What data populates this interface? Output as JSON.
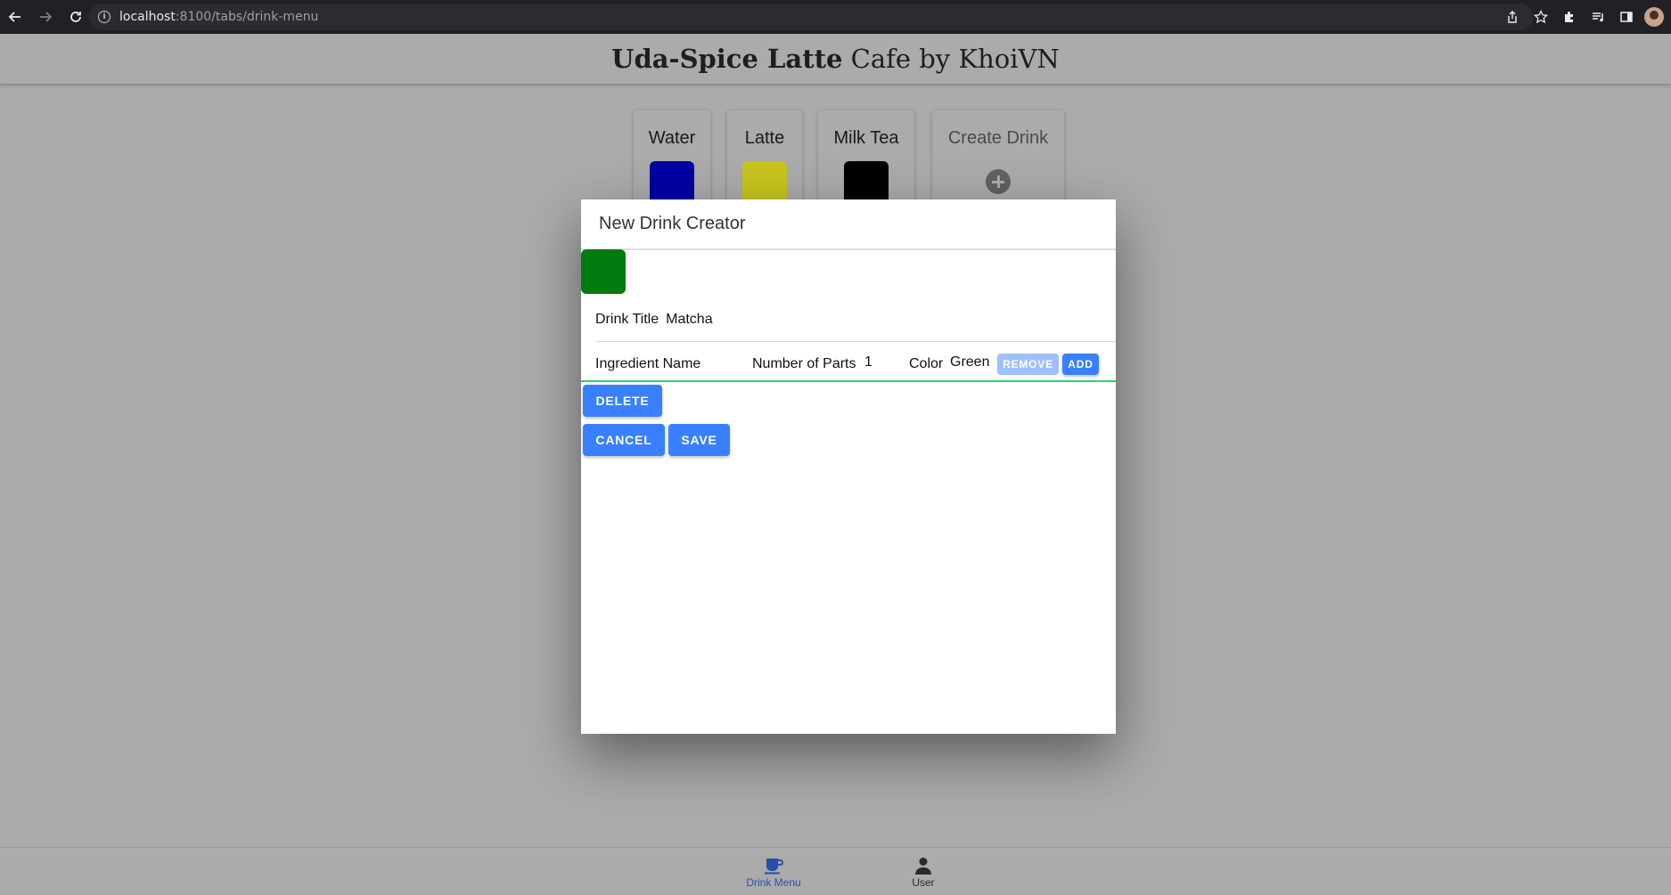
{
  "browser": {
    "url_host": "localhost",
    "url_path": ":8100/tabs/drink-menu"
  },
  "header": {
    "title_bold": "Uda-Spice Latte",
    "title_rest": " Cafe by KhoiVN"
  },
  "drinks": [
    {
      "title": "Water",
      "color": "#0000a3"
    },
    {
      "title": "Latte",
      "color": "#c8c51e"
    },
    {
      "title": "Milk Tea",
      "color": "#000000"
    }
  ],
  "create_card": {
    "title": "Create Drink",
    "icon": "plus-circle-icon"
  },
  "modal": {
    "title": "New Drink Creator",
    "swatch_color": "#007b0e",
    "drink_title_label": "Drink Title",
    "drink_title_value": "Matcha",
    "ingredient": {
      "name_label": "Ingredient Name",
      "name_value": "",
      "parts_label": "Number of Parts",
      "parts_value": "1",
      "color_label": "Color",
      "color_value": "Green",
      "remove_label": "REMOVE",
      "add_label": "ADD"
    },
    "delete_label": "DELETE",
    "cancel_label": "CANCEL",
    "save_label": "SAVE"
  },
  "tabs": [
    {
      "label": "Drink Menu",
      "icon": "cafe-icon",
      "active": true
    },
    {
      "label": "User",
      "icon": "person-icon",
      "active": false
    }
  ],
  "colors": {
    "accent": "#3880ff",
    "success": "#2dd36f",
    "chrome_bg": "#202124",
    "backdrop": "#ababab"
  }
}
